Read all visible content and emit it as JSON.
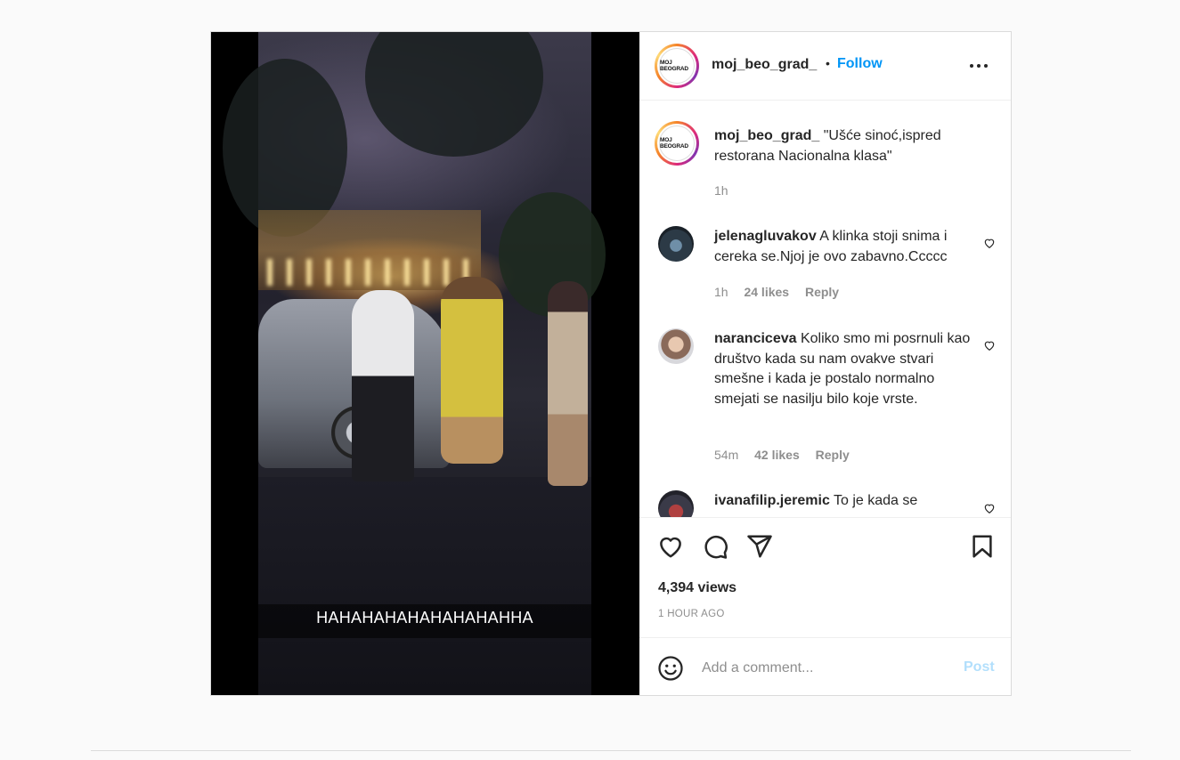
{
  "media": {
    "subtitle": "HAHAHAHAHAHAHAHAHHA"
  },
  "header": {
    "avatar_text": "MOJ BEOGRAD",
    "username": "moj_beo_grad_",
    "separator": "•",
    "follow_label": "Follow",
    "more_icon": "more-horizontal-icon"
  },
  "caption": {
    "avatar_text": "MOJ BEOGRAD",
    "username": "moj_beo_grad_",
    "text": "\"Ušće sinoć,ispred restorana Nacionalna klasa\"",
    "time": "1h"
  },
  "comments": [
    {
      "username": "jelenagluvakov",
      "text": "A klinka stoji snima i cereka se.Njoj je ovo zabavno.Ccccc",
      "time": "1h",
      "likes": "24 likes",
      "reply": "Reply"
    },
    {
      "username": "naranciceva",
      "text": "Koliko smo mi posrnuli kao društvo kada su nam ovakve stvari smešne i kada je postalo normalno smejati se nasilju bilo koje vrste.",
      "time": "54m",
      "likes": "42 likes",
      "reply": "Reply"
    },
    {
      "username": "ivanafilip.jeremic",
      "text": "To je kada se"
    }
  ],
  "actions": {
    "icons": [
      "heart-icon",
      "comment-icon",
      "share-icon",
      "bookmark-icon"
    ],
    "views": "4,394 views",
    "time_ago": "1 HOUR AGO"
  },
  "add_comment": {
    "placeholder": "Add a comment...",
    "post_label": "Post"
  },
  "colors": {
    "accent": "#0095f6",
    "post_disabled": "#b2dffc",
    "text": "#262626",
    "muted": "#8e8e8e",
    "border": "#dbdbdb"
  }
}
